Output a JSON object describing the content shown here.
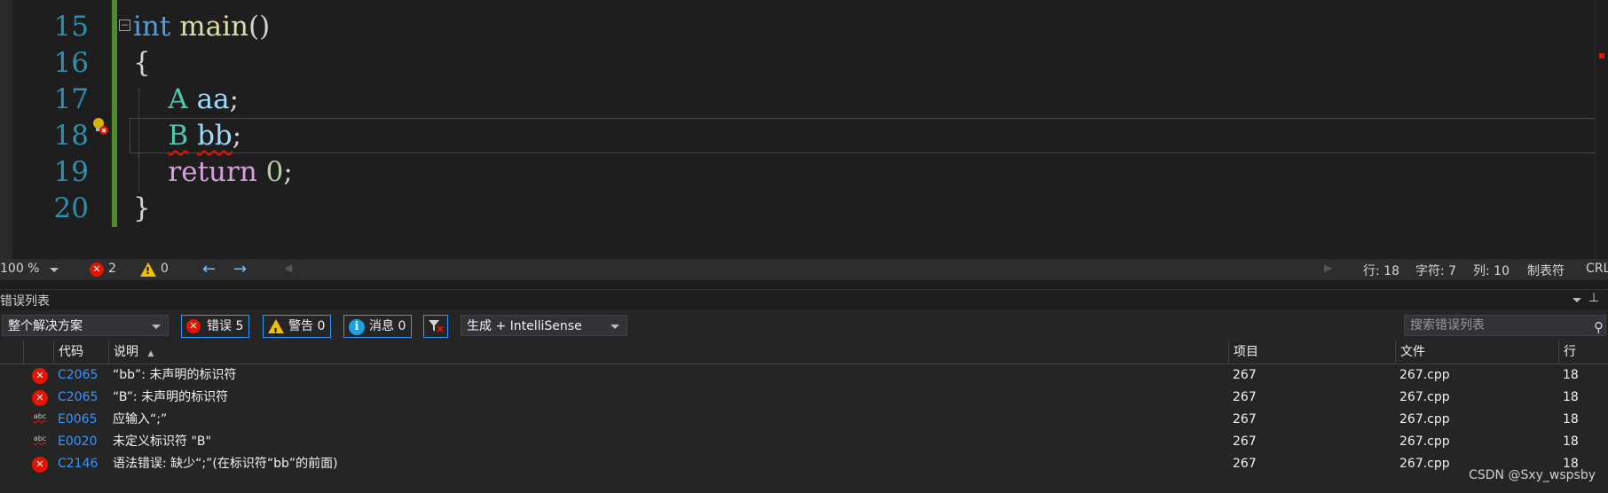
{
  "editor": {
    "lines": [
      {
        "num": "15",
        "tokens": [
          {
            "t": "int",
            "c": "kw"
          },
          {
            "t": " ",
            "c": "pl"
          },
          {
            "t": "main",
            "c": "fn"
          },
          {
            "t": "()",
            "c": "pl"
          }
        ]
      },
      {
        "num": "16",
        "tokens": [
          {
            "t": "{",
            "c": "pl"
          }
        ]
      },
      {
        "num": "17",
        "tokens": [
          {
            "t": "    ",
            "c": "pl"
          },
          {
            "t": "A",
            "c": "ty"
          },
          {
            "t": " ",
            "c": "pl"
          },
          {
            "t": "aa",
            "c": "id"
          },
          {
            "t": ";",
            "c": "pl"
          }
        ]
      },
      {
        "num": "18",
        "tokens": [
          {
            "t": "    ",
            "c": "pl"
          },
          {
            "t": "B",
            "c": "ty sq"
          },
          {
            "t": " ",
            "c": "pl"
          },
          {
            "t": "bb",
            "c": "id sq"
          },
          {
            "t": ";",
            "c": "pl"
          }
        ]
      },
      {
        "num": "19",
        "tokens": [
          {
            "t": "    ",
            "c": "pl"
          },
          {
            "t": "return",
            "c": "ctl"
          },
          {
            "t": " ",
            "c": "pl"
          },
          {
            "t": "0",
            "c": "num"
          },
          {
            "t": ";",
            "c": "pl"
          }
        ]
      },
      {
        "num": "20",
        "tokens": [
          {
            "t": "}",
            "c": "pl"
          }
        ]
      }
    ]
  },
  "status": {
    "zoom": "100 %",
    "errors": "2",
    "warnings": "0",
    "line": "行: 18",
    "char": "字符: 7",
    "col": "列: 10",
    "tabs": "制表符",
    "eol": "CRL"
  },
  "panel": {
    "title": "错误列表",
    "scope": "整个解决方案",
    "errors_btn": "错误 5",
    "warnings_btn": "警告 0",
    "messages_btn": "消息 0",
    "build_filter": "生成 + IntelliSense",
    "search_placeholder": "搜索错误列表"
  },
  "grid": {
    "headers": {
      "code": "代码",
      "desc": "说明",
      "project": "项目",
      "file": "文件",
      "line": "行"
    },
    "rows": [
      {
        "icon": "error",
        "code": "C2065",
        "desc": "“bb”: 未声明的标识符",
        "project": "267",
        "file": "267.cpp",
        "line": "18"
      },
      {
        "icon": "error",
        "code": "C2065",
        "desc": "“B”: 未声明的标识符",
        "project": "267",
        "file": "267.cpp",
        "line": "18"
      },
      {
        "icon": "abc",
        "code": "E0065",
        "desc": "应输入“;”",
        "project": "267",
        "file": "267.cpp",
        "line": "18"
      },
      {
        "icon": "abc",
        "code": "E0020",
        "desc": "未定义标识符 \"B\"",
        "project": "267",
        "file": "267.cpp",
        "line": "18"
      },
      {
        "icon": "error",
        "code": "C2146",
        "desc": "语法错误: 缺少“;”(在标识符“bb”的前面)",
        "project": "267",
        "file": "267.cpp",
        "line": "18"
      }
    ]
  },
  "watermark": "CSDN @Sxy_wspsby"
}
